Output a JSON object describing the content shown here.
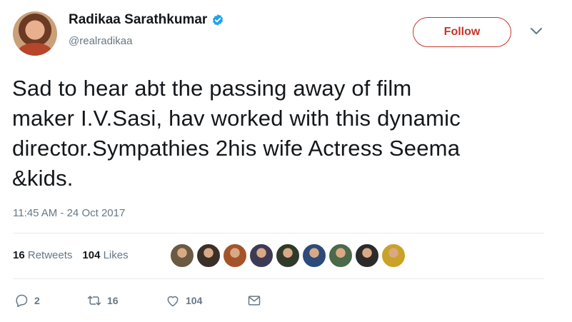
{
  "user": {
    "display_name": "Radikaa Sarathkumar",
    "handle": "@realradikaa"
  },
  "follow_label": "Follow",
  "tweet": {
    "lines": [
      "Sad to hear abt the passing away of film",
      "maker I.V.Sasi, hav worked with this dynamic",
      "director.Sympathies 2his wife Actress Seema",
      "&kids."
    ],
    "timestamp": "11:45 AM - 24 Oct 2017"
  },
  "stats": {
    "retweets_count": "16",
    "retweets_label": "Retweets",
    "likes_count": "104",
    "likes_label": "Likes"
  },
  "actions": {
    "reply_count": "2",
    "retweet_count": "16",
    "like_count": "104"
  },
  "icons": {
    "verified": "verified-badge-icon",
    "caret": "chevron-down-icon",
    "reply": "reply-icon",
    "retweet": "retweet-icon",
    "like": "heart-icon",
    "message": "envelope-icon"
  },
  "colors": {
    "follow_accent": "#c7352b",
    "verified_blue": "#1da1f2",
    "muted": "#657786"
  },
  "liker_colors": [
    "#6a5a43",
    "#3b2f2a",
    "#a4542b",
    "#3d3a55",
    "#2f3a2a",
    "#2c4a7a",
    "#4a6a4a",
    "#2b2b2b",
    "#c9a227"
  ]
}
